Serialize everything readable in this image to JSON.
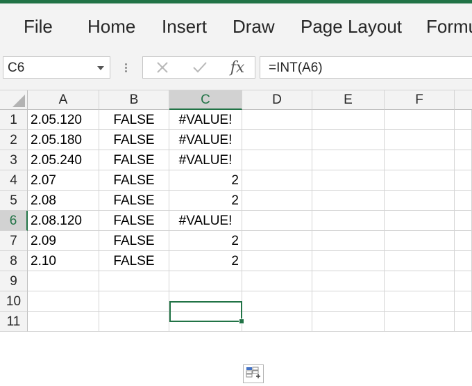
{
  "ribbon": {
    "tabs": [
      {
        "label": "File"
      },
      {
        "label": "Home"
      },
      {
        "label": "Insert"
      },
      {
        "label": "Draw"
      },
      {
        "label": "Page Layout"
      },
      {
        "label": "Formu"
      }
    ]
  },
  "formula_bar": {
    "name_box": "C6",
    "fx_label": "fx",
    "formula": "=INT(A6)",
    "icons": [
      "cancel-icon",
      "enter-check-icon",
      "insert-function-icon"
    ]
  },
  "sheet": {
    "columns": [
      "A",
      "B",
      "C",
      "D",
      "E",
      "F"
    ],
    "selected_cell": "C6",
    "rows": [
      {
        "num": "1",
        "a": "2.05.120",
        "b": "FALSE",
        "c": "#VALUE!"
      },
      {
        "num": "2",
        "a": "2.05.180",
        "b": "FALSE",
        "c": "#VALUE!"
      },
      {
        "num": "3",
        "a": "2.05.240",
        "b": "FALSE",
        "c": "#VALUE!"
      },
      {
        "num": "4",
        "a": "2.07",
        "b": "FALSE",
        "c": "2"
      },
      {
        "num": "5",
        "a": "2.08",
        "b": "FALSE",
        "c": "2"
      },
      {
        "num": "6",
        "a": "2.08.120",
        "b": "FALSE",
        "c": "#VALUE!"
      },
      {
        "num": "7",
        "a": "2.09",
        "b": "FALSE",
        "c": "2"
      },
      {
        "num": "8",
        "a": "2.10",
        "b": "FALSE",
        "c": "2"
      },
      {
        "num": "9",
        "a": "",
        "b": "",
        "c": ""
      },
      {
        "num": "10",
        "a": "",
        "b": "",
        "c": ""
      },
      {
        "num": "11",
        "a": "",
        "b": "",
        "c": ""
      }
    ]
  },
  "quick_analysis_icon": "quick-analysis-icon",
  "colors": {
    "accent": "#217346"
  }
}
